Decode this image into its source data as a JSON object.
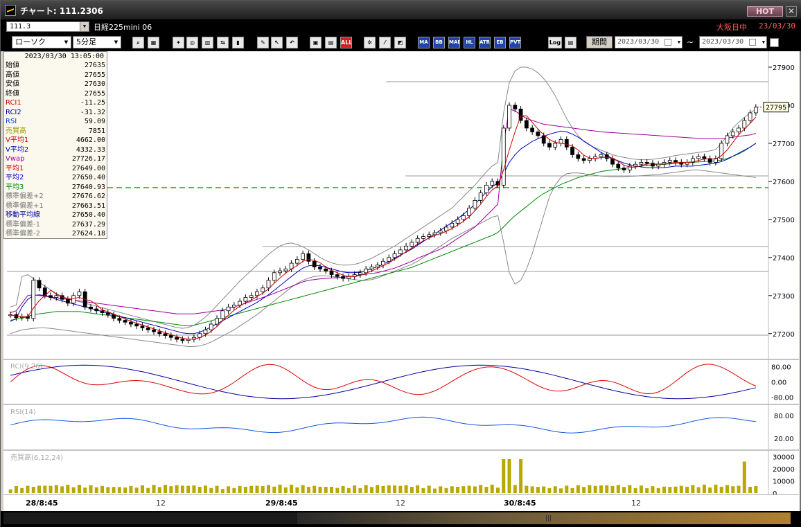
{
  "window": {
    "title": "チャート: 111.2306",
    "hot_label": "HOT",
    "close_label": "✕"
  },
  "symbol_bar": {
    "symbol": "111.3",
    "instrument": "日経225mini 06",
    "market_status": "大阪日中",
    "date": "23/03/30"
  },
  "toolbar": {
    "chart_type": "ローソク",
    "interval": "5分足",
    "buttons": [
      "zoom-icon",
      "layout-icon",
      "marker-icon",
      "find-icon",
      "chart-icon",
      "compare-icon",
      "bookmark-icon",
      "pen-icon",
      "cursor-icon",
      "undo-icon",
      "mark-icon",
      "mark2-icon",
      "all-icon",
      "settings-icon",
      "brush-icon",
      "palette-icon"
    ],
    "indicator_buttons": [
      "MA",
      "BB",
      "MAE",
      "HL",
      "ATR",
      "EB",
      "PVT"
    ],
    "all_label": "ALL",
    "log_label": "Log",
    "period_label": "期間",
    "date_from": "2023/03/30",
    "date_to": "2023/03/30",
    "tilde": "~"
  },
  "info_panel": {
    "timestamp": "2023/03/30  13:05:00",
    "rows": [
      {
        "label": "始値",
        "value": "27635",
        "color": "#000000"
      },
      {
        "label": "高値",
        "value": "27655",
        "color": "#000000"
      },
      {
        "label": "安値",
        "value": "27630",
        "color": "#000000"
      },
      {
        "label": "終値",
        "value": "27655",
        "color": "#000000"
      },
      {
        "label": "RCI1",
        "value": "-11.25",
        "color": "#cc0000"
      },
      {
        "label": "RCI2",
        "value": "-31.32",
        "color": "#000099"
      },
      {
        "label": "RSI",
        "value": "59.09",
        "color": "#0044cc"
      },
      {
        "label": "売買高",
        "value": "7851",
        "color": "#999900"
      },
      {
        "label": "V平均1",
        "value": "4662.00",
        "color": "#cc0000"
      },
      {
        "label": "V平均2",
        "value": "4332.33",
        "color": "#0000cc"
      },
      {
        "label": "Vwap",
        "value": "27726.17",
        "color": "#990099"
      },
      {
        "label": "平均1",
        "value": "27649.00",
        "color": "#cc0000"
      },
      {
        "label": "平均2",
        "value": "27650.40",
        "color": "#0000cc"
      },
      {
        "label": "平均3",
        "value": "27640.93",
        "color": "#008800"
      },
      {
        "label": "標準偏差+2",
        "value": "27676.62",
        "color": "#777777"
      },
      {
        "label": "標準偏差+1",
        "value": "27663.51",
        "color": "#777777"
      },
      {
        "label": "移動平均線",
        "value": "27650.40",
        "color": "#000099"
      },
      {
        "label": "標準偏差-1",
        "value": "27637.29",
        "color": "#777777"
      },
      {
        "label": "標準偏差-2",
        "value": "27624.18",
        "color": "#777777"
      }
    ]
  },
  "chart_data": {
    "type": "line",
    "price_ticks": [
      "27900",
      "27800",
      "27700",
      "27600",
      "27500",
      "27400",
      "27300",
      "27200"
    ],
    "price_ylim": [
      27145,
      27920
    ],
    "last_price": "27795",
    "price_series": {
      "close": [
        27250,
        27242,
        27245,
        27240,
        27340,
        27320,
        27300,
        27295,
        27300,
        27290,
        27280,
        27300,
        27310,
        27270,
        27265,
        27260,
        27255,
        27250,
        27240,
        27235,
        27230,
        27225,
        27220,
        27215,
        27210,
        27205,
        27200,
        27195,
        27190,
        27185,
        27182,
        27185,
        27190,
        27200,
        27210,
        27225,
        27240,
        27260,
        27270,
        27275,
        27285,
        27295,
        27300,
        27310,
        27320,
        27340,
        27360,
        27365,
        27370,
        27385,
        27395,
        27410,
        27390,
        27375,
        27370,
        27365,
        27355,
        27350,
        27345,
        27350,
        27355,
        27360,
        27370,
        27375,
        27380,
        27390,
        27400,
        27410,
        27420,
        27430,
        27440,
        27450,
        27455,
        27460,
        27465,
        27470,
        27480,
        27490,
        27500,
        27510,
        27530,
        27550,
        27570,
        27590,
        27600,
        27590,
        27740,
        27800,
        27790,
        27760,
        27740,
        27730,
        27720,
        27700,
        27690,
        27700,
        27710,
        27690,
        27670,
        27660,
        27655,
        27660,
        27665,
        27670,
        27660,
        27645,
        27635,
        27630,
        27640,
        27645,
        27650,
        27648,
        27640,
        27645,
        27650,
        27655,
        27650,
        27645,
        27650,
        27660,
        27665,
        27660,
        27650,
        27660,
        27700,
        27720,
        27730,
        27740,
        27760,
        27780,
        27795
      ],
      "vwap": [
        27255,
        27260,
        27280,
        27300,
        27302,
        27300,
        27298,
        27296,
        27294,
        27292,
        27290,
        27288,
        27286,
        27284,
        27282,
        27280,
        27278,
        27276,
        27274,
        27272,
        27270,
        27268,
        27266,
        27264,
        27262,
        27260,
        27258,
        27256,
        27254,
        27252,
        27252,
        27252,
        27252,
        27254,
        27256,
        27258,
        27260,
        27262,
        27266,
        27270,
        27275,
        27280,
        27285,
        27290,
        27295,
        27300,
        27306,
        27312,
        27318,
        27324,
        27330,
        27336,
        27340,
        27342,
        27344,
        27345,
        27346,
        27347,
        27348,
        27350,
        27352,
        27354,
        27356,
        27358,
        27360,
        27364,
        27368,
        27372,
        27378,
        27384,
        27390,
        27398,
        27404,
        27410,
        27416,
        27422,
        27430,
        27440,
        27450,
        27460,
        27470,
        27480,
        27495,
        27510,
        27525,
        27540,
        27700,
        27790,
        27785,
        27775,
        27765,
        27760,
        27755,
        27750,
        27748,
        27746,
        27744,
        27742,
        27740,
        27738,
        27736,
        27734,
        27732,
        27730,
        27729,
        27728,
        27727,
        27726,
        27725,
        27724,
        27723,
        27722,
        27721,
        27720,
        27719,
        27718,
        27717,
        27716,
        27715,
        27714,
        27713,
        27712,
        27712,
        27712,
        27712,
        27714,
        27716,
        27718,
        27720,
        27722,
        27726
      ],
      "ma3": [
        27235,
        27238,
        27240,
        27245,
        27250,
        27252,
        27254,
        27256,
        27258,
        27258,
        27258,
        27258,
        27258,
        27256,
        27254,
        27252,
        27250,
        27248,
        27246,
        27244,
        27242,
        27240,
        27238,
        27236,
        27234,
        27232,
        27230,
        27228,
        27226,
        27224,
        27222,
        27220,
        27222,
        27226,
        27230,
        27234,
        27238,
        27242,
        27246,
        27250,
        27254,
        27258,
        27262,
        27266,
        27270,
        27274,
        27278,
        27282,
        27286,
        27290,
        27294,
        27298,
        27302,
        27306,
        27310,
        27314,
        27318,
        27322,
        27326,
        27330,
        27334,
        27338,
        27342,
        27346,
        27350,
        27354,
        27358,
        27362,
        27366,
        27370,
        27374,
        27380,
        27386,
        27392,
        27398,
        27404,
        27410,
        27416,
        27422,
        27428,
        27434,
        27440,
        27446,
        27452,
        27458,
        27466,
        27480,
        27496,
        27510,
        27522,
        27534,
        27546,
        27558,
        27568,
        27576,
        27584,
        27592,
        27598,
        27604,
        27610,
        27614,
        27618,
        27622,
        27626,
        27628,
        27630,
        27632,
        27634,
        27636,
        27638,
        27640,
        27642,
        27643,
        27644,
        27645,
        27646,
        27647,
        27648,
        27649,
        27650,
        27651,
        27652,
        27653,
        27654,
        27656,
        27660,
        27666,
        27672,
        27680,
        27690,
        27700
      ],
      "ma2": [
        27232,
        27240,
        27270,
        27290,
        27300,
        27302,
        27300,
        27296,
        27290,
        27286,
        27282,
        27278,
        27274,
        27270,
        27266,
        27262,
        27258,
        27254,
        27250,
        27246,
        27242,
        27238,
        27234,
        27230,
        27226,
        27222,
        27218,
        27214,
        27210,
        27206,
        27202,
        27200,
        27200,
        27204,
        27210,
        27218,
        27226,
        27234,
        27242,
        27250,
        27258,
        27266,
        27274,
        27282,
        27292,
        27302,
        27314,
        27326,
        27338,
        27350,
        27362,
        27372,
        27378,
        27380,
        27378,
        27374,
        27370,
        27366,
        27362,
        27360,
        27360,
        27362,
        27366,
        27370,
        27376,
        27382,
        27390,
        27398,
        27406,
        27414,
        27422,
        27432,
        27442,
        27452,
        27462,
        27472,
        27482,
        27492,
        27502,
        27514,
        27526,
        27540,
        27556,
        27572,
        27586,
        27596,
        27620,
        27650,
        27670,
        27685,
        27695,
        27705,
        27712,
        27718,
        27724,
        27728,
        27732,
        27730,
        27724,
        27716,
        27706,
        27696,
        27686,
        27676,
        27668,
        27660,
        27654,
        27648,
        27644,
        27640,
        27638,
        27636,
        27636,
        27636,
        27636,
        27638,
        27640,
        27640,
        27640,
        27640,
        27642,
        27644,
        27646,
        27648,
        27652,
        27658,
        27666,
        27674,
        27682,
        27690,
        27700
      ],
      "bb_upper": [
        27270,
        27275,
        27350,
        27355,
        27345,
        27335,
        27325,
        27315,
        27305,
        27298,
        27292,
        27288,
        27284,
        27280,
        27276,
        27272,
        27268,
        27264,
        27260,
        27256,
        27252,
        27248,
        27244,
        27240,
        27236,
        27232,
        27228,
        27224,
        27220,
        27216,
        27214,
        27216,
        27222,
        27232,
        27244,
        27258,
        27274,
        27290,
        27306,
        27322,
        27338,
        27352,
        27366,
        27380,
        27394,
        27408,
        27420,
        27430,
        27436,
        27438,
        27434,
        27428,
        27420,
        27410,
        27400,
        27392,
        27386,
        27382,
        27380,
        27380,
        27382,
        27386,
        27392,
        27398,
        27406,
        27414,
        27422,
        27430,
        27440,
        27450,
        27460,
        27470,
        27480,
        27490,
        27500,
        27510,
        27520,
        27530,
        27545,
        27560,
        27575,
        27590,
        27608,
        27625,
        27640,
        27650,
        27780,
        27860,
        27890,
        27900,
        27900,
        27895,
        27885,
        27870,
        27850,
        27825,
        27795,
        27765,
        27740,
        27720,
        27705,
        27695,
        27688,
        27682,
        27676,
        27670,
        27666,
        27663,
        27660,
        27658,
        27657,
        27657,
        27658,
        27660,
        27662,
        27665,
        27668,
        27670,
        27672,
        27674,
        27676,
        27678,
        27680,
        27684,
        27700,
        27720,
        27740,
        27755,
        27768,
        27780,
        27790
      ],
      "bb_lower": [
        27200,
        27205,
        27210,
        27212,
        27214,
        27215,
        27215,
        27214,
        27212,
        27210,
        27208,
        27206,
        27204,
        27202,
        27200,
        27198,
        27196,
        27194,
        27192,
        27190,
        27188,
        27186,
        27184,
        27182,
        27180,
        27178,
        27176,
        27174,
        27172,
        27170,
        27168,
        27166,
        27166,
        27168,
        27172,
        27178,
        27186,
        27194,
        27202,
        27210,
        27220,
        27230,
        27240,
        27250,
        27262,
        27274,
        27286,
        27298,
        27310,
        27322,
        27332,
        27340,
        27346,
        27350,
        27352,
        27352,
        27350,
        27348,
        27346,
        27344,
        27342,
        27340,
        27340,
        27342,
        27346,
        27352,
        27358,
        27364,
        27370,
        27376,
        27382,
        27390,
        27400,
        27410,
        27420,
        27430,
        27440,
        27450,
        27458,
        27466,
        27474,
        27482,
        27490,
        27498,
        27506,
        27510,
        27440,
        27360,
        27330,
        27340,
        27370,
        27410,
        27460,
        27510,
        27560,
        27590,
        27610,
        27620,
        27622,
        27622,
        27620,
        27618,
        27616,
        27614,
        27613,
        27612,
        27612,
        27612,
        27613,
        27614,
        27615,
        27616,
        27617,
        27618,
        27620,
        27622,
        27624,
        27626,
        27628,
        27630,
        27630,
        27628,
        27626,
        27624,
        27622,
        27620,
        27618,
        27616,
        27614,
        27612,
        27610
      ]
    },
    "indicator_panels": [
      {
        "name": "RCI(9,26)",
        "ticks": [
          "80.00",
          "0.00",
          "-80.00"
        ]
      },
      {
        "name": "RSI(14)",
        "ticks": [
          "80.00",
          "20.00"
        ]
      },
      {
        "name": "売買高(6,12,24)",
        "ticks": [
          "30000",
          "20000",
          "10000",
          "0"
        ]
      }
    ],
    "x_labels": [
      {
        "label": "28/8:45",
        "bold": true
      },
      {
        "label": "12",
        "bold": false
      },
      {
        "label": "29/8:45",
        "bold": true
      },
      {
        "label": "12",
        "bold": false
      },
      {
        "label": "30/8:45",
        "bold": true
      },
      {
        "label": "12",
        "bold": false
      }
    ],
    "colors": {
      "candle": "#000000",
      "ma1": "#cc0000",
      "ma2": "#0000cc",
      "ma3": "#008800",
      "vwap": "#990099",
      "bb": "#888888",
      "dashed": "#008800",
      "rci1": "#dd0000",
      "rci2": "#000099",
      "rsi": "#1155dd",
      "volume": "#b8a800",
      "last_price_marker": "#cc0000"
    }
  },
  "scrollbar": {
    "grip": "|||"
  }
}
